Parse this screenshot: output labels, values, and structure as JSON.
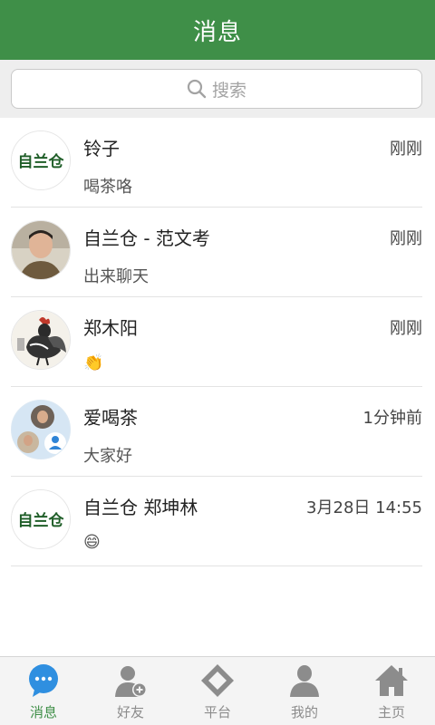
{
  "header": {
    "title": "消息"
  },
  "search": {
    "placeholder": "搜索"
  },
  "conversations": [
    {
      "name": "铃子",
      "time": "刚刚",
      "message": "喝茶咯",
      "avatar": "zilancang-logo",
      "logo_text": "自兰仓"
    },
    {
      "name": "自兰仓 - 范文考",
      "time": "刚刚",
      "message": "出来聊天",
      "avatar": "person-photo"
    },
    {
      "name": "郑木阳",
      "time": "刚刚",
      "message": "👏",
      "avatar": "rooster-painting"
    },
    {
      "name": "爱喝茶",
      "time": "1分钟前",
      "message": "大家好",
      "avatar": "group-avatar"
    },
    {
      "name": "自兰仓 郑坤林",
      "time": "3月28日 14:55",
      "message": "😄",
      "avatar": "zilancang-logo",
      "logo_text": "自兰仓"
    }
  ],
  "tabbar": {
    "items": [
      {
        "label": "消息",
        "icon": "chat-bubble-icon",
        "active": true
      },
      {
        "label": "好友",
        "icon": "add-friend-icon",
        "active": false
      },
      {
        "label": "平台",
        "icon": "platform-diamond-icon",
        "active": false
      },
      {
        "label": "我的",
        "icon": "person-icon",
        "active": false
      },
      {
        "label": "主页",
        "icon": "home-icon",
        "active": false
      }
    ]
  },
  "colors": {
    "accent": "#3f8f48",
    "tab_inactive": "#8c8c8c"
  }
}
